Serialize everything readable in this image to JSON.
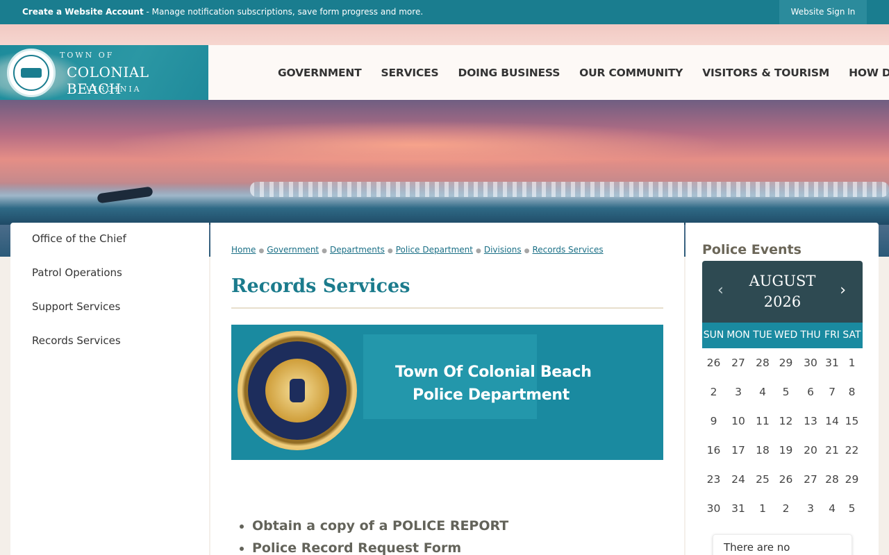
{
  "topbar": {
    "account_link": "Create a Website Account",
    "account_desc": " - Manage notification subscriptions, save form progress and more.",
    "signin": "Website Sign In"
  },
  "logo": {
    "line1": "TOWN OF",
    "line2": "COLONIAL BEACH",
    "line3": "VIRGINIA"
  },
  "nav": [
    "GOVERNMENT",
    "SERVICES",
    "DOING BUSINESS",
    "OUR COMMUNITY",
    "VISITORS & TOURISM",
    "HOW DO I..."
  ],
  "sidebar": [
    "Office of the Chief",
    "Patrol Operations",
    "Support Services",
    "Records Services"
  ],
  "breadcrumb": [
    "Home",
    "Government",
    "Departments",
    "Police Department",
    "Divisions",
    "Records Services"
  ],
  "page_title": "Records Services",
  "banner": {
    "line1": "Town Of Colonial Beach",
    "line2": "Police Department"
  },
  "links": [
    "Obtain a copy of a POLICE REPORT",
    "Police Record Request Form"
  ],
  "events": {
    "title": "Police Events",
    "month": "AUGUST",
    "year": "2026",
    "days_of_week": [
      "SUN",
      "MON",
      "TUE",
      "WED",
      "THU",
      "FRI",
      "SAT"
    ],
    "dates": [
      [
        "26",
        "27",
        "28",
        "29",
        "30",
        "31",
        "1"
      ],
      [
        "2",
        "3",
        "4",
        "5",
        "6",
        "7",
        "8"
      ],
      [
        "9",
        "10",
        "11",
        "12",
        "13",
        "14",
        "15"
      ],
      [
        "16",
        "17",
        "18",
        "19",
        "20",
        "21",
        "22"
      ],
      [
        "23",
        "24",
        "25",
        "26",
        "27",
        "28",
        "29"
      ],
      [
        "30",
        "31",
        "1",
        "2",
        "3",
        "4",
        "5"
      ]
    ],
    "no_events": "There are no"
  },
  "colors": {
    "teal": "#1a7d8f",
    "calendar_header": "#2e4a52",
    "accent": "#1a8aa0"
  }
}
